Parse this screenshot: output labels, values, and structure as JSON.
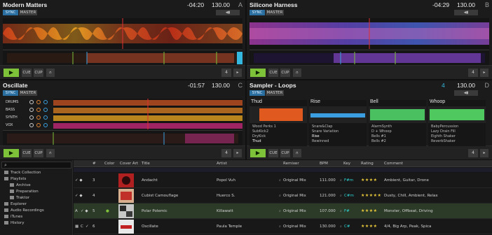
{
  "decks": {
    "a": {
      "title": "Modern Matters",
      "time": "-04:20",
      "bpm": "130.00",
      "letter": "A",
      "sync": "SYNC",
      "master": "MASTER",
      "cue": "CUE",
      "cup": "CUP",
      "loop": "4"
    },
    "b": {
      "title": "Silicone Harness",
      "time": "-04:29",
      "bpm": "130.00",
      "letter": "B",
      "sync": "SYNC",
      "master": "MASTER",
      "cue": "CUE",
      "cup": "CUP",
      "loop": "4"
    },
    "c": {
      "title": "Oscillate",
      "time": "-01:57",
      "bpm": "130.00",
      "letter": "C",
      "sync": "SYNC",
      "master": "MASTER",
      "cue": "CUE",
      "cup": "CUP",
      "loop": "4",
      "stems": [
        "DRUMS",
        "BASS",
        "SYNTH",
        "VOX"
      ]
    },
    "d": {
      "title": "Sampler - Loops",
      "time": "4",
      "bpm": "130.00",
      "letter": "D",
      "sync": "SYNC",
      "master": "MASTER",
      "cue": "CUE",
      "cup": "CUP",
      "loop": "4",
      "slots": [
        {
          "name": "Thud",
          "items": [
            "Wood Perks 1",
            "SubKick2",
            "DryKick",
            "Thud"
          ]
        },
        {
          "name": "Rise",
          "items": [
            "Snare&Clap",
            "Snare Variation",
            "Rise",
            "Rewinned"
          ]
        },
        {
          "name": "Bell",
          "items": [
            "AlarmSynth",
            "D + Whoop",
            "Bells #1",
            "Bells #2"
          ]
        },
        {
          "name": "Whoop",
          "items": [
            "BabyPercussion",
            "Lazy Drain Fill",
            "Eighth Shaker",
            "ReverbShaker"
          ]
        }
      ]
    }
  },
  "colors": {
    "accent_green": "#7ec23a",
    "sync_blue": "#2a6fa0",
    "key_cyan": "#2fd6d6",
    "star_yellow": "#e8c83a"
  },
  "browser": {
    "search_placeholder": "⌕",
    "tree": [
      "Track Collection",
      "Playlists",
      "Archive",
      "Preparation",
      "Traktor",
      "Explorer",
      "Audio Recordings",
      "iTunes",
      "History"
    ],
    "columns": {
      "num": "#",
      "color": "Color",
      "cover": "Cover Art",
      "title": "Title",
      "artist": "Artist",
      "remixer": "Remixer",
      "bpm": "BPM",
      "key": "Key",
      "rating": "Rating",
      "comment": "Comment"
    },
    "rows": [
      {
        "num": "3",
        "title": "Andacht",
        "artist": "Popol Vuh",
        "remixer": "Original Mix",
        "bpm": "111.000",
        "key": "F#m",
        "rating": "★★★★",
        "comment": "Ambient, Guitar, Drone"
      },
      {
        "num": "4",
        "title": "Cubist Camouflage",
        "artist": "Huerco S.",
        "remixer": "Original Mix",
        "bpm": "121.000",
        "key": "C#m",
        "rating": "★★★★★",
        "comment": "Dusty, Chill, Ambient, Relax"
      },
      {
        "num": "5",
        "title": "Polar Polemic",
        "artist": "Killawatt",
        "remixer": "Original Mix",
        "bpm": "107.000",
        "key": "F#",
        "rating": "★★★★",
        "comment": "Monster, Offbeat, Driving",
        "deck": "A"
      },
      {
        "num": "6",
        "title": "Oscillate",
        "artist": "Paula Temple",
        "remixer": "Original Mix",
        "bpm": "130.000",
        "key": "C#",
        "rating": "★★★★",
        "comment": "4/4, Big Arp, Peak, Spica",
        "deck": "C"
      }
    ]
  }
}
